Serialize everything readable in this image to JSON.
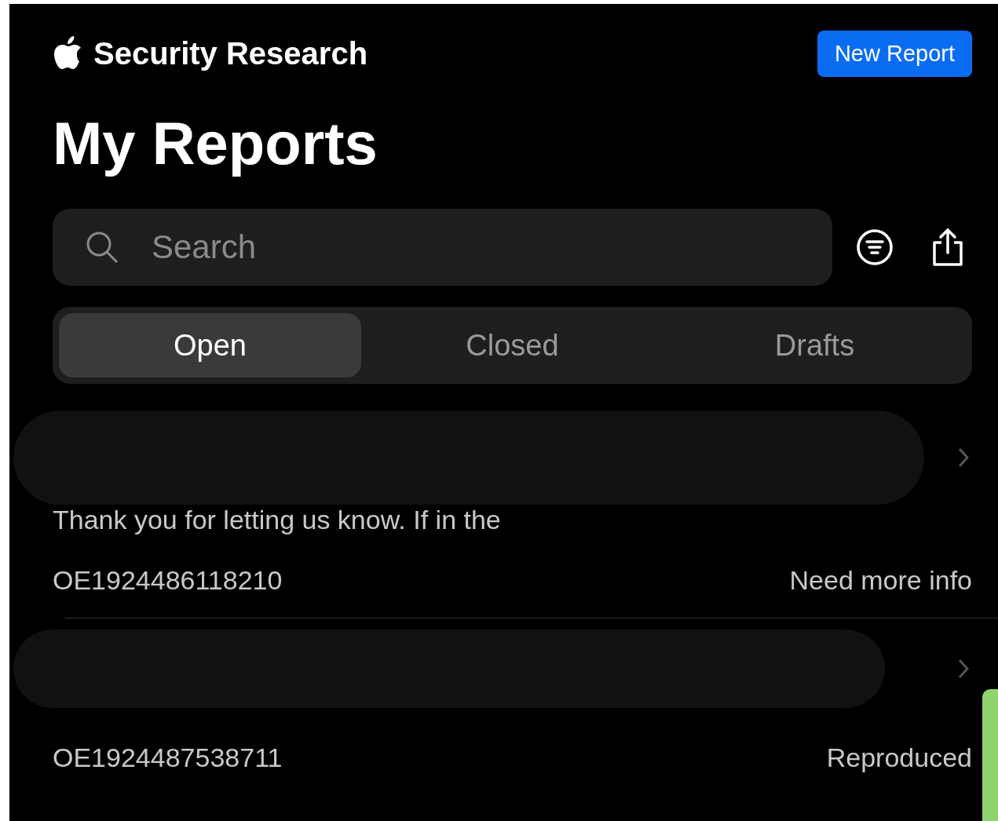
{
  "header": {
    "title": "Security Research",
    "new_report_button": "New Report"
  },
  "heading": "My Reports",
  "search": {
    "placeholder": "Search"
  },
  "tabs": [
    {
      "label": "Open",
      "selected": true
    },
    {
      "label": "Closed",
      "selected": false
    },
    {
      "label": "Drafts",
      "selected": false
    }
  ],
  "reports": [
    {
      "preview": "Thank you for letting us know. If in the",
      "id": "OE1924486118210",
      "status": "Need more info"
    },
    {
      "id": "OE1924487538711",
      "status": "Reproduced"
    }
  ]
}
